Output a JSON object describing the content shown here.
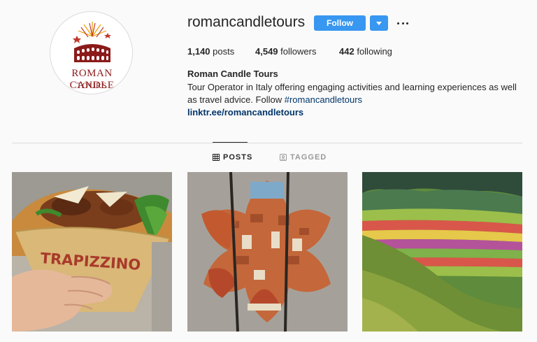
{
  "profile": {
    "username": "romancandletours",
    "posts_count": "1,140",
    "posts_label": "posts",
    "followers_count": "4,549",
    "followers_label": "followers",
    "following_count": "442",
    "following_label": "following",
    "full_name": "Roman Candle Tours",
    "bio_text": "Tour Operator in Italy offering engaging activities and learning experiences as well as travel advice. Follow",
    "bio_hashtag": "#romancandletours",
    "link": "linktr.ee/romancandletours",
    "avatar_logo": {
      "line1": "ROMAN CANDLE",
      "line2": "TOURS"
    }
  },
  "actions": {
    "follow_label": "Follow"
  },
  "tabs": [
    {
      "label": "POSTS",
      "active": true
    },
    {
      "label": "TAGGED",
      "active": false
    }
  ],
  "posts": [
    {
      "name": "post-trapizzino-sandwich",
      "printed_text": "TRAPIZZINO"
    },
    {
      "name": "post-florence-view-through-window"
    },
    {
      "name": "post-flowering-valley"
    }
  ],
  "colors": {
    "accent": "#3897f0",
    "link": "#003569",
    "text": "#262626",
    "muted": "#999999",
    "border": "#dbdbdb",
    "background": "#fafafa"
  }
}
